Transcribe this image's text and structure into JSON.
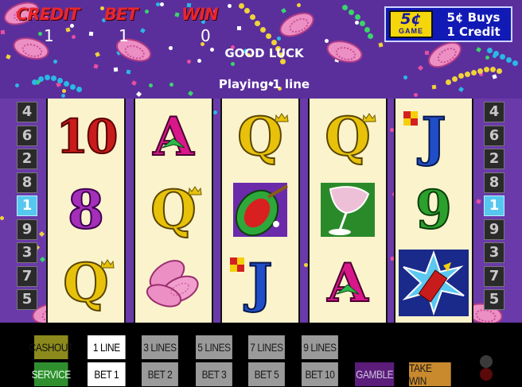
{
  "header": {
    "credit_label": "CREDIT",
    "bet_label": "BET",
    "win_label": "WIN",
    "credit_value": "1",
    "bet_value": "1",
    "win_value": "0",
    "message": "GOOD LUCK",
    "lines_message": "Playing 1 line"
  },
  "denomination": {
    "badge_value": "5¢",
    "badge_caption": "GAME",
    "rate_line1": "5¢ Buys",
    "rate_line2": "1 Credit"
  },
  "left_line_numbers": [
    "4",
    "6",
    "2",
    "8",
    "1",
    "9",
    "3",
    "7",
    "5"
  ],
  "right_line_numbers": [
    "4",
    "6",
    "2",
    "8",
    "1",
    "9",
    "3",
    "7",
    "5"
  ],
  "active_line": "1",
  "reels": [
    {
      "symbols": [
        {
          "name": "ten",
          "text": "10"
        },
        {
          "name": "eight",
          "text": "8"
        },
        {
          "name": "queen",
          "text": "Q"
        }
      ]
    },
    {
      "symbols": [
        {
          "name": "ace",
          "text": "A"
        },
        {
          "name": "queen",
          "text": "Q"
        },
        {
          "name": "coins",
          "text": ""
        }
      ]
    },
    {
      "symbols": [
        {
          "name": "queen",
          "text": "Q"
        },
        {
          "name": "tambourine",
          "text": ""
        },
        {
          "name": "jack",
          "text": "J"
        }
      ]
    },
    {
      "symbols": [
        {
          "name": "queen",
          "text": "Q"
        },
        {
          "name": "champagne",
          "text": ""
        },
        {
          "name": "ace",
          "text": "A"
        }
      ]
    },
    {
      "symbols": [
        {
          "name": "jack",
          "text": "J"
        },
        {
          "name": "nine",
          "text": "9"
        },
        {
          "name": "firework",
          "text": ""
        }
      ]
    }
  ],
  "buttons": {
    "cashout": "CASHOUT",
    "service": "SERVICE",
    "lines_1": "1 LINE",
    "lines_3": "3 LINES",
    "lines_5": "5 LINES",
    "lines_7": "7 LINES",
    "lines_9": "9 LINES",
    "bet_1": "BET 1",
    "bet_2": "BET 2",
    "bet_3": "BET 3",
    "bet_5": "BET 5",
    "bet_10": "BET 10",
    "gamble": "GAMBLE",
    "take_win": "TAKE WIN"
  },
  "colors": {
    "background": "#5a2f9c",
    "label_red": "#e8262e",
    "reel_bg": "#fbf3cc",
    "active_line": "#56c8f0",
    "cashout": "#8c8a1c",
    "service": "#2f8f2f",
    "gamble": "#5b1c7a",
    "take_win": "#c98a2e"
  }
}
